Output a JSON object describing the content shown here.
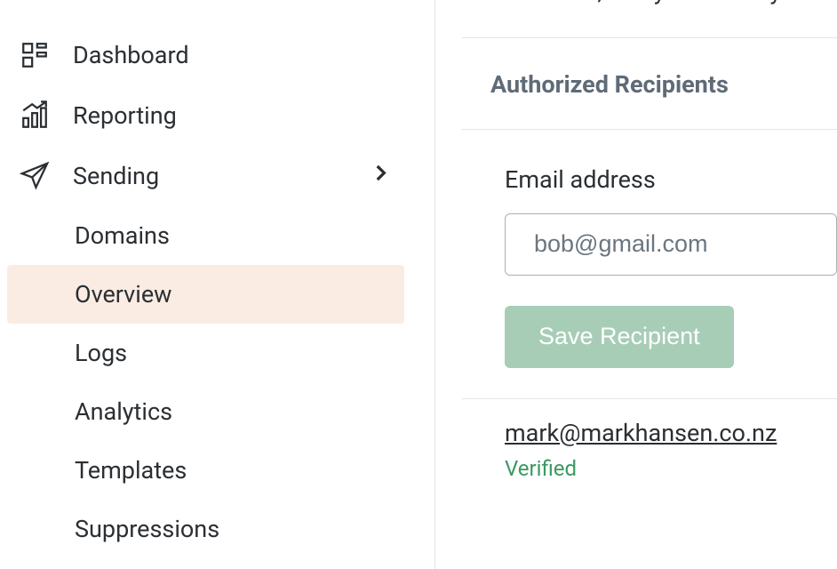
{
  "sidebar": {
    "dashboard": "Dashboard",
    "reporting": "Reporting",
    "sending": "Sending",
    "sub": {
      "domains": "Domains",
      "overview": "Overview",
      "logs": "Logs",
      "analytics": "Analytics",
      "templates": "Templates",
      "suppressions": "Suppressions"
    }
  },
  "main": {
    "intro_fragment": "credentials, and you're ready to",
    "section_title": "Authorized Recipients",
    "email_label": "Email address",
    "email_placeholder": "bob@gmail.com",
    "save_button": "Save Recipient",
    "recipient_email": "mark@markhansen.co.nz",
    "verified_label": "Verified"
  },
  "colors": {
    "active_bg": "#faece2",
    "button_bg": "#a7cdb6",
    "verified": "#3a9a61",
    "muted": "#5f6b77",
    "text": "#2b2f33",
    "border": "#e5e5e5"
  }
}
